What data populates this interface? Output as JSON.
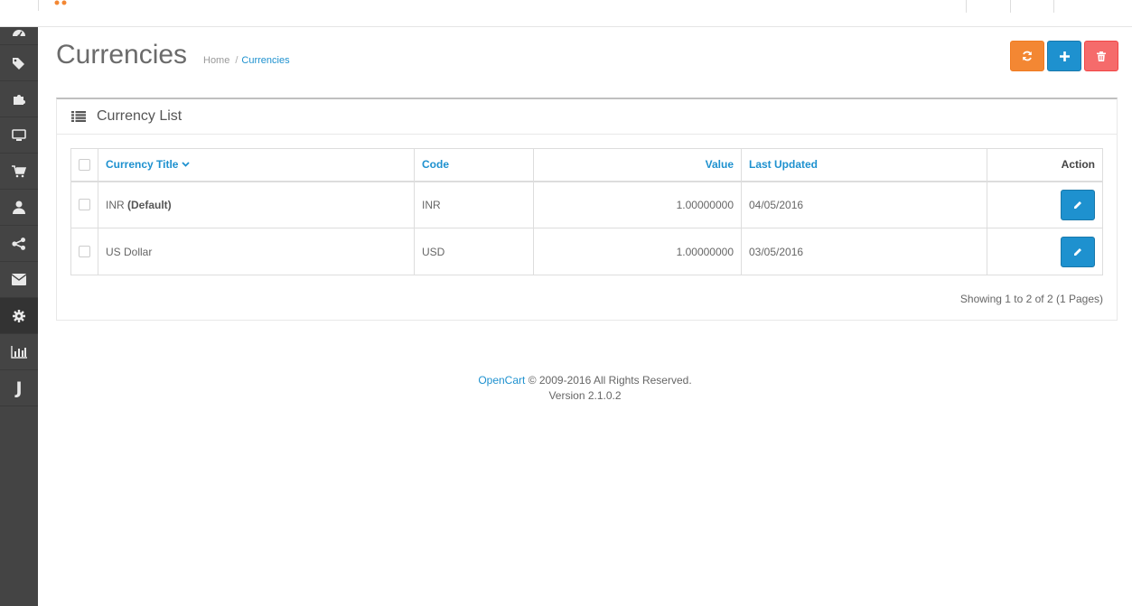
{
  "colors": {
    "sidebar_bg": "#444444",
    "primary": "#1e91cf",
    "warning": "#f38733",
    "danger": "#f56b6b",
    "logo": "#f38733"
  },
  "header": {
    "logo_icon": "shopping-cart-logo-icon"
  },
  "sidebar": {
    "items": [
      {
        "icon": "dashboard-icon",
        "label": ""
      },
      {
        "icon": "tags-icon",
        "label": ""
      },
      {
        "icon": "puzzle-icon",
        "label": ""
      },
      {
        "icon": "monitor-icon",
        "label": ""
      },
      {
        "icon": "shopping-cart-icon",
        "label": ""
      },
      {
        "icon": "user-icon",
        "label": ""
      },
      {
        "icon": "share-icon",
        "label": ""
      },
      {
        "icon": "envelope-icon",
        "label": ""
      },
      {
        "icon": "cog-icon",
        "label": "",
        "active": true
      },
      {
        "icon": "bar-chart-icon",
        "label": ""
      },
      {
        "icon": "j-icon",
        "label": "J"
      }
    ]
  },
  "page": {
    "title": "Currencies",
    "breadcrumb": {
      "home": "Home",
      "separator": "/",
      "current": "Currencies"
    },
    "actions": {
      "refresh_icon": "refresh-icon",
      "add_icon": "plus-icon",
      "delete_icon": "trash-icon"
    }
  },
  "panel": {
    "title": "Currency List",
    "icon": "list-icon",
    "columns": {
      "title": "Currency Title",
      "code": "Code",
      "value": "Value",
      "last_updated": "Last Updated",
      "action": "Action"
    },
    "rows": [
      {
        "title": "INR",
        "default_label": "(Default)",
        "code": "INR",
        "value": "1.00000000",
        "last_updated": "04/05/2016"
      },
      {
        "title": "US Dollar",
        "default_label": "",
        "code": "USD",
        "value": "1.00000000",
        "last_updated": "03/05/2016"
      }
    ],
    "results": "Showing 1 to 2 of 2 (1 Pages)"
  },
  "footer": {
    "link": "OpenCart",
    "copyright": "© 2009-2016 All Rights Reserved.",
    "version": "Version 2.1.0.2"
  }
}
